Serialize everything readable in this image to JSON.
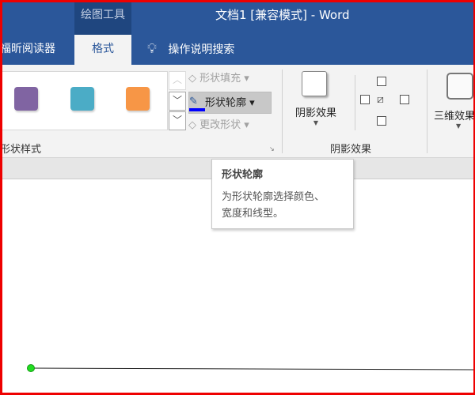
{
  "window": {
    "context_tab": "绘图工具",
    "title": "文档1 [兼容模式]  -  Word"
  },
  "tabs": [
    {
      "label": "福昕阅读器"
    },
    {
      "label": "格式"
    }
  ],
  "search": {
    "label": "操作说明搜索",
    "icon": "lightbulb-icon"
  },
  "styles": {
    "swatches": [
      "#8064a2",
      "#4bacc6",
      "#f79646"
    ],
    "group_label": "形状样式"
  },
  "commands": {
    "fill": "形状填充",
    "outline": "形状轮廓",
    "change": "更改形状",
    "outline_color": "#0000ff"
  },
  "shadow": {
    "button": "阴影效果",
    "group_label": "阴影效果"
  },
  "threed": {
    "button": "三维效果"
  },
  "tooltip": {
    "title": "形状轮廓",
    "line1": "为形状轮廓选择颜色、",
    "line2": "宽度和线型。"
  },
  "colors": {
    "title_bg": "#2b579a",
    "frame": "#e00000",
    "handle": "#22dd22"
  }
}
